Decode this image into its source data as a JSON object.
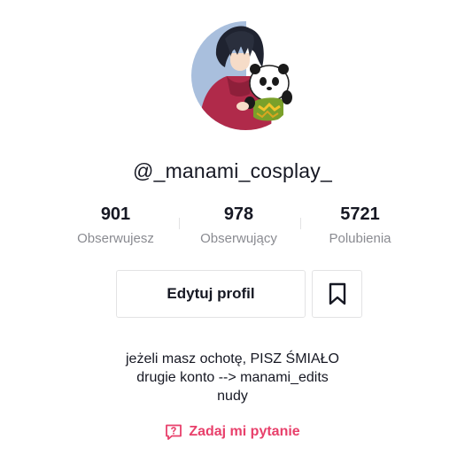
{
  "profile": {
    "username": "@_manami_cosplay_",
    "avatar_icon": "anime-character-with-panda-avatar"
  },
  "stats": [
    {
      "value": "901",
      "label": "Obserwujesz"
    },
    {
      "value": "978",
      "label": "Obserwujący"
    },
    {
      "value": "5721",
      "label": "Polubienia"
    }
  ],
  "actions": {
    "edit_profile_label": "Edytuj profil",
    "bookmark_icon": "bookmark-icon"
  },
  "bio": {
    "lines": [
      "jeżeli masz ochotę, PISZ ŚMIAŁO",
      "drugie konto --> manami_edits",
      "nudy"
    ]
  },
  "question": {
    "label": "Zadaj mi pytanie",
    "icon": "question-bubble-icon"
  },
  "colors": {
    "text": "#161823",
    "muted": "#8a8b91",
    "border": "#e3e3e4",
    "accent": "#e8406b"
  }
}
